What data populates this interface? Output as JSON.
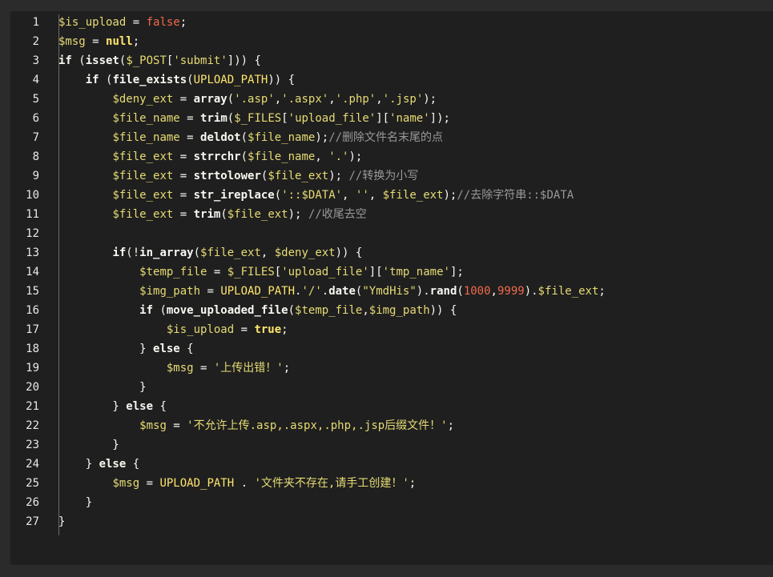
{
  "colors": {
    "background": "#1f1f1f",
    "variable": "#e6db74",
    "keyword": "#f8f8f2",
    "string": "#e6db74",
    "boolean_number": "#f06a4a",
    "comment": "#999999",
    "line_number": "#e8e8e8"
  },
  "line_numbers": [
    "1",
    "2",
    "3",
    "4",
    "5",
    "6",
    "7",
    "8",
    "9",
    "10",
    "11",
    "12",
    "13",
    "14",
    "15",
    "16",
    "17",
    "18",
    "19",
    "20",
    "21",
    "22",
    "23",
    "24",
    "25",
    "26",
    "27"
  ],
  "code_lines": [
    [
      {
        "t": "var",
        "v": "$is_upload"
      },
      {
        "t": "op",
        "v": " = "
      },
      {
        "t": "bool",
        "v": "false"
      },
      {
        "t": "op",
        "v": ";"
      }
    ],
    [
      {
        "t": "var",
        "v": "$msg"
      },
      {
        "t": "op",
        "v": " = "
      },
      {
        "t": "null",
        "v": "null"
      },
      {
        "t": "op",
        "v": ";"
      }
    ],
    [
      {
        "t": "kw",
        "v": "if"
      },
      {
        "t": "op",
        "v": " ("
      },
      {
        "t": "fn",
        "v": "isset"
      },
      {
        "t": "op",
        "v": "("
      },
      {
        "t": "var",
        "v": "$_POST"
      },
      {
        "t": "op",
        "v": "["
      },
      {
        "t": "str",
        "v": "'submit'"
      },
      {
        "t": "op",
        "v": "])) {"
      }
    ],
    [
      {
        "t": "op",
        "v": "    "
      },
      {
        "t": "kw",
        "v": "if"
      },
      {
        "t": "op",
        "v": " ("
      },
      {
        "t": "fn",
        "v": "file_exists"
      },
      {
        "t": "op",
        "v": "("
      },
      {
        "t": "const",
        "v": "UPLOAD_PATH"
      },
      {
        "t": "op",
        "v": ")) {"
      }
    ],
    [
      {
        "t": "op",
        "v": "        "
      },
      {
        "t": "var",
        "v": "$deny_ext"
      },
      {
        "t": "op",
        "v": " = "
      },
      {
        "t": "fn",
        "v": "array"
      },
      {
        "t": "op",
        "v": "("
      },
      {
        "t": "str",
        "v": "'.asp'"
      },
      {
        "t": "op",
        "v": ","
      },
      {
        "t": "str",
        "v": "'.aspx'"
      },
      {
        "t": "op",
        "v": ","
      },
      {
        "t": "str",
        "v": "'.php'"
      },
      {
        "t": "op",
        "v": ","
      },
      {
        "t": "str",
        "v": "'.jsp'"
      },
      {
        "t": "op",
        "v": ");"
      }
    ],
    [
      {
        "t": "op",
        "v": "        "
      },
      {
        "t": "var",
        "v": "$file_name"
      },
      {
        "t": "op",
        "v": " = "
      },
      {
        "t": "fn",
        "v": "trim"
      },
      {
        "t": "op",
        "v": "("
      },
      {
        "t": "var",
        "v": "$_FILES"
      },
      {
        "t": "op",
        "v": "["
      },
      {
        "t": "str",
        "v": "'upload_file'"
      },
      {
        "t": "op",
        "v": "]["
      },
      {
        "t": "str",
        "v": "'name'"
      },
      {
        "t": "op",
        "v": "]);"
      }
    ],
    [
      {
        "t": "op",
        "v": "        "
      },
      {
        "t": "var",
        "v": "$file_name"
      },
      {
        "t": "op",
        "v": " = "
      },
      {
        "t": "fn",
        "v": "deldot"
      },
      {
        "t": "op",
        "v": "("
      },
      {
        "t": "var",
        "v": "$file_name"
      },
      {
        "t": "op",
        "v": ");"
      },
      {
        "t": "cmt",
        "v": "//删除文件名末尾的点"
      }
    ],
    [
      {
        "t": "op",
        "v": "        "
      },
      {
        "t": "var",
        "v": "$file_ext"
      },
      {
        "t": "op",
        "v": " = "
      },
      {
        "t": "fn",
        "v": "strrchr"
      },
      {
        "t": "op",
        "v": "("
      },
      {
        "t": "var",
        "v": "$file_name"
      },
      {
        "t": "op",
        "v": ", "
      },
      {
        "t": "str",
        "v": "'.'"
      },
      {
        "t": "op",
        "v": ");"
      }
    ],
    [
      {
        "t": "op",
        "v": "        "
      },
      {
        "t": "var",
        "v": "$file_ext"
      },
      {
        "t": "op",
        "v": " = "
      },
      {
        "t": "fn",
        "v": "strtolower"
      },
      {
        "t": "op",
        "v": "("
      },
      {
        "t": "var",
        "v": "$file_ext"
      },
      {
        "t": "op",
        "v": "); "
      },
      {
        "t": "cmt",
        "v": "//转换为小写"
      }
    ],
    [
      {
        "t": "op",
        "v": "        "
      },
      {
        "t": "var",
        "v": "$file_ext"
      },
      {
        "t": "op",
        "v": " = "
      },
      {
        "t": "fn",
        "v": "str_ireplace"
      },
      {
        "t": "op",
        "v": "("
      },
      {
        "t": "str",
        "v": "'::$DATA'"
      },
      {
        "t": "op",
        "v": ", "
      },
      {
        "t": "str",
        "v": "''"
      },
      {
        "t": "op",
        "v": ", "
      },
      {
        "t": "var",
        "v": "$file_ext"
      },
      {
        "t": "op",
        "v": ");"
      },
      {
        "t": "cmt",
        "v": "//去除字符串::$DATA"
      }
    ],
    [
      {
        "t": "op",
        "v": "        "
      },
      {
        "t": "var",
        "v": "$file_ext"
      },
      {
        "t": "op",
        "v": " = "
      },
      {
        "t": "fn",
        "v": "trim"
      },
      {
        "t": "op",
        "v": "("
      },
      {
        "t": "var",
        "v": "$file_ext"
      },
      {
        "t": "op",
        "v": "); "
      },
      {
        "t": "cmt",
        "v": "//收尾去空"
      }
    ],
    [],
    [
      {
        "t": "op",
        "v": "        "
      },
      {
        "t": "kw",
        "v": "if"
      },
      {
        "t": "op",
        "v": "(!"
      },
      {
        "t": "fn",
        "v": "in_array"
      },
      {
        "t": "op",
        "v": "("
      },
      {
        "t": "var",
        "v": "$file_ext"
      },
      {
        "t": "op",
        "v": ", "
      },
      {
        "t": "var",
        "v": "$deny_ext"
      },
      {
        "t": "op",
        "v": ")) {"
      }
    ],
    [
      {
        "t": "op",
        "v": "            "
      },
      {
        "t": "var",
        "v": "$temp_file"
      },
      {
        "t": "op",
        "v": " = "
      },
      {
        "t": "var",
        "v": "$_FILES"
      },
      {
        "t": "op",
        "v": "["
      },
      {
        "t": "str",
        "v": "'upload_file'"
      },
      {
        "t": "op",
        "v": "]["
      },
      {
        "t": "str",
        "v": "'tmp_name'"
      },
      {
        "t": "op",
        "v": "];"
      }
    ],
    [
      {
        "t": "op",
        "v": "            "
      },
      {
        "t": "var",
        "v": "$img_path"
      },
      {
        "t": "op",
        "v": " = "
      },
      {
        "t": "const",
        "v": "UPLOAD_PATH"
      },
      {
        "t": "op",
        "v": "."
      },
      {
        "t": "str",
        "v": "'/'"
      },
      {
        "t": "op",
        "v": "."
      },
      {
        "t": "fn",
        "v": "date"
      },
      {
        "t": "op",
        "v": "("
      },
      {
        "t": "str",
        "v": "\"YmdHis\""
      },
      {
        "t": "op",
        "v": ")."
      },
      {
        "t": "fn",
        "v": "rand"
      },
      {
        "t": "op",
        "v": "("
      },
      {
        "t": "num",
        "v": "1000"
      },
      {
        "t": "op",
        "v": ","
      },
      {
        "t": "num",
        "v": "9999"
      },
      {
        "t": "op",
        "v": ")."
      },
      {
        "t": "var",
        "v": "$file_ext"
      },
      {
        "t": "op",
        "v": ";"
      }
    ],
    [
      {
        "t": "op",
        "v": "            "
      },
      {
        "t": "kw",
        "v": "if"
      },
      {
        "t": "op",
        "v": " ("
      },
      {
        "t": "fn",
        "v": "move_uploaded_file"
      },
      {
        "t": "op",
        "v": "("
      },
      {
        "t": "var",
        "v": "$temp_file"
      },
      {
        "t": "op",
        "v": ","
      },
      {
        "t": "var",
        "v": "$img_path"
      },
      {
        "t": "op",
        "v": ")) {"
      }
    ],
    [
      {
        "t": "op",
        "v": "                "
      },
      {
        "t": "var",
        "v": "$is_upload"
      },
      {
        "t": "op",
        "v": " = "
      },
      {
        "t": "null",
        "v": "true"
      },
      {
        "t": "op",
        "v": ";"
      }
    ],
    [
      {
        "t": "op",
        "v": "            } "
      },
      {
        "t": "kw",
        "v": "else"
      },
      {
        "t": "op",
        "v": " {"
      }
    ],
    [
      {
        "t": "op",
        "v": "                "
      },
      {
        "t": "var",
        "v": "$msg"
      },
      {
        "t": "op",
        "v": " = "
      },
      {
        "t": "str",
        "v": "'上传出错！'"
      },
      {
        "t": "op",
        "v": ";"
      }
    ],
    [
      {
        "t": "op",
        "v": "            }"
      }
    ],
    [
      {
        "t": "op",
        "v": "        } "
      },
      {
        "t": "kw",
        "v": "else"
      },
      {
        "t": "op",
        "v": " {"
      }
    ],
    [
      {
        "t": "op",
        "v": "            "
      },
      {
        "t": "var",
        "v": "$msg"
      },
      {
        "t": "op",
        "v": " = "
      },
      {
        "t": "str",
        "v": "'不允许上传.asp,.aspx,.php,.jsp后缀文件！'"
      },
      {
        "t": "op",
        "v": ";"
      }
    ],
    [
      {
        "t": "op",
        "v": "        }"
      }
    ],
    [
      {
        "t": "op",
        "v": "    } "
      },
      {
        "t": "kw",
        "v": "else"
      },
      {
        "t": "op",
        "v": " {"
      }
    ],
    [
      {
        "t": "op",
        "v": "        "
      },
      {
        "t": "var",
        "v": "$msg"
      },
      {
        "t": "op",
        "v": " = "
      },
      {
        "t": "const",
        "v": "UPLOAD_PATH"
      },
      {
        "t": "op",
        "v": " . "
      },
      {
        "t": "str",
        "v": "'文件夹不存在,请手工创建！'"
      },
      {
        "t": "op",
        "v": ";"
      }
    ],
    [
      {
        "t": "op",
        "v": "    }"
      }
    ],
    [
      {
        "t": "op",
        "v": "}"
      }
    ]
  ]
}
